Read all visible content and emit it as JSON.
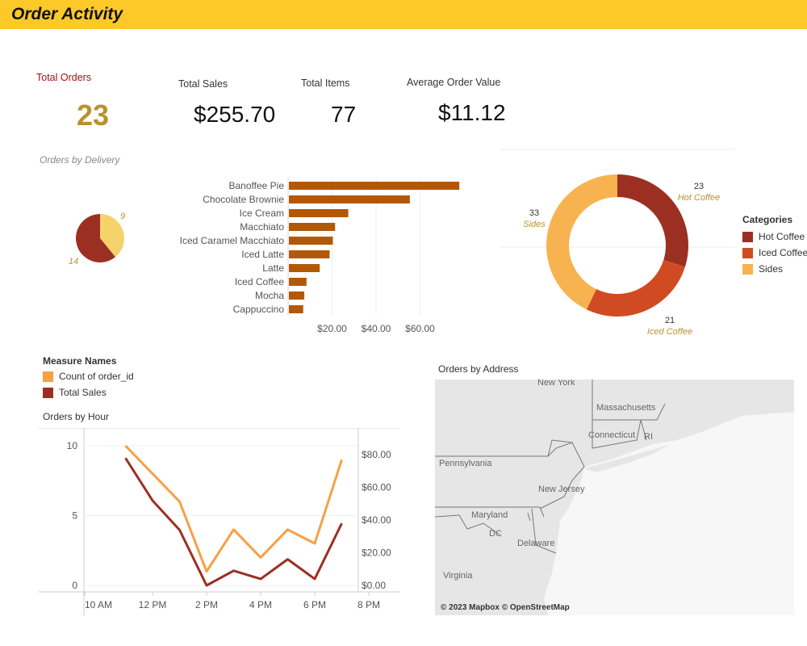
{
  "header": {
    "title": "Order Activity"
  },
  "kpis": {
    "total_orders": {
      "label": "Total Orders",
      "value": "23"
    },
    "total_sales": {
      "label": "Total Sales",
      "value": "$255.70"
    },
    "total_items": {
      "label": "Total Items",
      "value": "77"
    },
    "avg_order_value": {
      "label": "Average Order Value",
      "value": "$11.12"
    }
  },
  "colors": {
    "header": "#fcc928",
    "bar": "#b35806",
    "hot_coffee": "#9b3022",
    "iced_coffee": "#d14b22",
    "sides": "#f7b34f",
    "count_line": "#f7a044",
    "sales_line": "#9b3022",
    "delivery_dark": "#9b3022",
    "delivery_light": "#f5d26a",
    "gold_text": "#b8922e",
    "red_label": "#a50f15"
  },
  "chart_data": [
    {
      "type": "pie",
      "title": "Orders by Delivery",
      "values": [
        9,
        14
      ],
      "labels": [
        "9",
        "14"
      ]
    },
    {
      "type": "bar",
      "orientation": "horizontal",
      "categories": [
        "Banoffee Pie",
        "Chocolate Brownie",
        "Ice Cream",
        "Macchiato",
        "Iced Caramel Macchiato",
        "Iced Latte",
        "Latte",
        "Iced Coffee",
        "Mocha",
        "Cappuccino"
      ],
      "values": [
        77.5,
        55,
        27,
        21,
        20,
        18.5,
        14,
        8,
        7,
        6.5
      ],
      "xticks": [
        "$20.00",
        "$40.00",
        "$60.00"
      ],
      "xlim": [
        0,
        80
      ],
      "grid": true
    },
    {
      "type": "pie",
      "donut": true,
      "legend_title": "Categories",
      "categories": [
        "Hot Coffee",
        "Iced Coffee",
        "Sides"
      ],
      "values": [
        23,
        21,
        33
      ],
      "legend_position": "right"
    },
    {
      "type": "line",
      "title": "Orders by Hour",
      "legend_title": "Measure Names",
      "x": [
        "11 AM",
        "12 PM",
        "1 PM",
        "2 PM",
        "3 PM",
        "4 PM",
        "5 PM",
        "6 PM",
        "7 PM"
      ],
      "xticks": [
        "10 AM",
        "12 PM",
        "2 PM",
        "4 PM",
        "6 PM",
        "8 PM"
      ],
      "series": [
        {
          "name": "Count of order_id",
          "axis": "left",
          "values": [
            10,
            8,
            6,
            1,
            4,
            2,
            4,
            3,
            9
          ]
        },
        {
          "name": "Total Sales",
          "axis": "right",
          "values": [
            78,
            52,
            34,
            0,
            9,
            4,
            16,
            4,
            38
          ]
        }
      ],
      "yticks_left": [
        "10",
        "5",
        "0"
      ],
      "yticks_right": [
        "$80.00",
        "$60.00",
        "$40.00",
        "$20.00",
        "$0.00"
      ],
      "ylim_left": [
        0,
        11
      ],
      "ylim_right": [
        0,
        85
      ]
    }
  ],
  "map": {
    "title": "Orders by Address",
    "attribution": "© 2023 Mapbox © OpenStreetMap",
    "places": [
      "New York",
      "Massachusetts",
      "Connecticut",
      "RI",
      "Pennsylvania",
      "New Jersey",
      "Maryland",
      "DC",
      "Delaware",
      "Virginia"
    ]
  }
}
